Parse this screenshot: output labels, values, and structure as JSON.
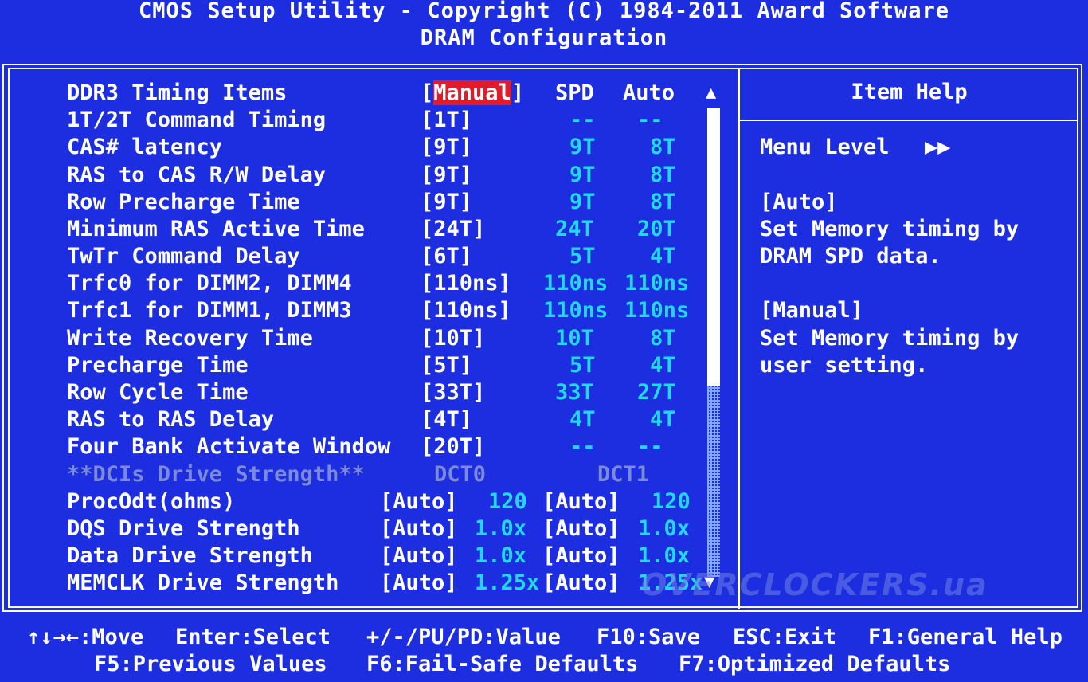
{
  "header": {
    "title": "CMOS Setup Utility - Copyright (C) 1984-2011 Award Software",
    "subtitle": "DRAM Configuration"
  },
  "columns": {
    "spd": "SPD",
    "auto": "Auto"
  },
  "timing_items": [
    {
      "label": "DDR3 Timing Items",
      "value": "[Manual]",
      "spd": "",
      "auto": ""
    },
    {
      "label": "1T/2T Command Timing",
      "value": "[1T]",
      "spd": "--",
      "auto": "--"
    },
    {
      "label": "CAS# latency",
      "value": "[9T]",
      "spd": "9T",
      "auto": "8T"
    },
    {
      "label": "RAS to CAS R/W Delay",
      "value": "[9T]",
      "spd": "9T",
      "auto": "8T"
    },
    {
      "label": "Row Precharge Time",
      "value": "[9T]",
      "spd": "9T",
      "auto": "8T"
    },
    {
      "label": "Minimum RAS Active Time",
      "value": "[24T]",
      "spd": "24T",
      "auto": "20T"
    },
    {
      "label": "TwTr Command Delay",
      "value": "[6T]",
      "spd": "5T",
      "auto": "4T"
    },
    {
      "label": "Trfc0 for DIMM2, DIMM4",
      "value": "[110ns]",
      "spd": "110ns",
      "auto": "110ns"
    },
    {
      "label": "Trfc1 for DIMM1, DIMM3",
      "value": "[110ns]",
      "spd": "110ns",
      "auto": "110ns"
    },
    {
      "label": "Write Recovery Time",
      "value": "[10T]",
      "spd": "10T",
      "auto": "8T"
    },
    {
      "label": "Precharge Time",
      "value": "[5T]",
      "spd": "5T",
      "auto": "4T"
    },
    {
      "label": "Row Cycle Time",
      "value": "[33T]",
      "spd": "33T",
      "auto": "27T"
    },
    {
      "label": "RAS to RAS Delay",
      "value": "[4T]",
      "spd": "4T",
      "auto": "4T"
    },
    {
      "label": "Four Bank Activate Window",
      "value": "[20T]",
      "spd": "--",
      "auto": "--"
    }
  ],
  "selected_value_text": "Manual",
  "dct_section": {
    "label": "**DCIs Drive Strength**",
    "dct0": "DCT0",
    "dct1": "DCT1"
  },
  "dct_items": [
    {
      "label": "ProcOdt(ohms)",
      "dct0_value": "[Auto]",
      "dct0_current": "120",
      "dct1_value": "[Auto]",
      "dct1_current": "120"
    },
    {
      "label": "DQS Drive Strength",
      "dct0_value": "[Auto]",
      "dct0_current": "1.0x",
      "dct1_value": "[Auto]",
      "dct1_current": "1.0x"
    },
    {
      "label": "Data Drive Strength",
      "dct0_value": "[Auto]",
      "dct0_current": "1.0x",
      "dct1_value": "[Auto]",
      "dct1_current": "1.0x"
    },
    {
      "label": "MEMCLK Drive Strength",
      "dct0_value": "[Auto]",
      "dct0_current": "1.25x",
      "dct1_value": "[Auto]",
      "dct1_current": "1.25x"
    }
  ],
  "help": {
    "title": "Item Help",
    "menu_level": "Menu Level",
    "menu_level_glyph": "▶▶",
    "auto_heading": "[Auto]",
    "auto_line1": "Set Memory timing by",
    "auto_line2": "DRAM SPD data.",
    "manual_heading": "[Manual]",
    "manual_line1": "Set Memory timing by",
    "manual_line2": "user setting."
  },
  "watermark": "OVERCLOCKERS.ua",
  "footer": {
    "move": "↑↓→←:Move",
    "enter": "Enter:Select",
    "value": "+/-/PU/PD:Value",
    "save": "F10:Save",
    "exit": "ESC:Exit",
    "help": "F1:General Help",
    "prev": "F5:Previous Values",
    "failsafe": "F6:Fail-Safe Defaults",
    "optimized": "F7:Optimized Defaults"
  },
  "colors": {
    "background": "#1c2ee0",
    "highlight": "#e21b2b",
    "cyan": "#22d8f0",
    "disabled": "#7b8ad9"
  }
}
